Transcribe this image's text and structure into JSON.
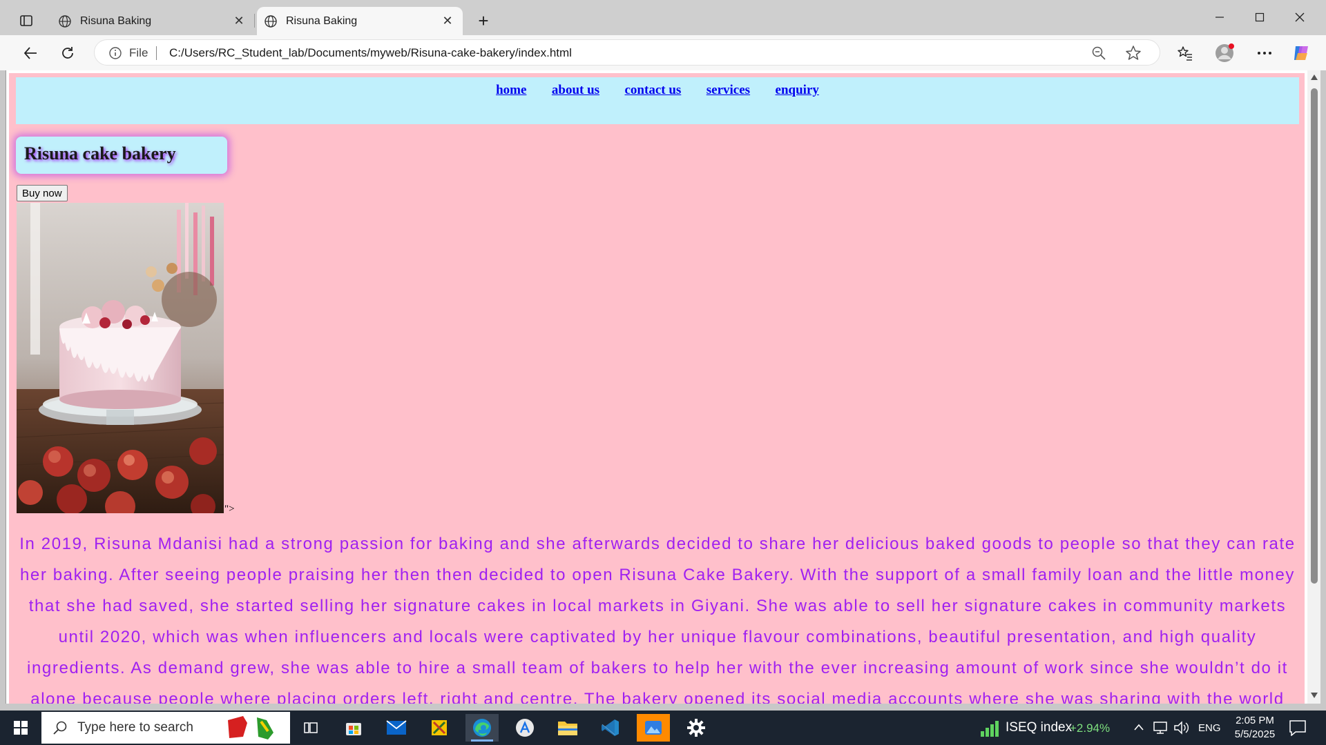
{
  "browser": {
    "tabs": [
      {
        "title": "Risuna Baking",
        "active": false
      },
      {
        "title": "Risuna Baking",
        "active": true
      }
    ],
    "address": {
      "scheme_label": "File",
      "url": "C:/Users/RC_Student_lab/Documents/myweb/Risuna-cake-bakery/index.html"
    },
    "icons": {
      "tab_actions": "tab-actions-icon",
      "back": "back-arrow-icon",
      "refresh": "refresh-icon",
      "info": "info-icon",
      "zoom": "zoom-out-icon",
      "favorite": "star-icon",
      "favorites": "favorites-icon",
      "profile": "profile-icon",
      "more": "more-icon",
      "copilot": "copilot-icon"
    }
  },
  "page": {
    "background": "#ffc0cb",
    "nav_background": "#c0f0fc",
    "nav_links": [
      "home",
      "about us",
      "contact us",
      "services",
      "enquiry"
    ],
    "brand_title": "Risuna cake bakery",
    "buy_button": "Buy now",
    "image_alt": "Pink drip cake topped with macarons on a glass stand",
    "stray_text": "\">",
    "text_color": "#a020f0",
    "story_lines": [
      "In 2019, Risuna Mdanisi had a strong passion for baking and she afterwards decided to share her delicious baked goods to people so that they can rate",
      "her baking. After seeing people praising her then then decided to open Risuna Cake Bakery. With the support of a small family loan and the little money",
      "that she had saved, she started selling her signature cakes in local markets in Giyani. She was able to sell her signature cakes in community markets",
      "until 2020, which was when influencers and locals were captivated by her unique flavour combinations, beautiful presentation, and high quality",
      "ingredients. As demand grew, she was able to hire a small team of bakers to help her with the ever increasing amount of work since she wouldn’t do it",
      "alone because people where placing orders left, right and centre. The bakery opened its social media accounts where she was sharing with the world"
    ]
  },
  "taskbar": {
    "search_placeholder": "Type here to search",
    "stock_name": "ISEQ index",
    "stock_change": "+2.94%",
    "language": "ENG",
    "time": "2:05 PM",
    "date": "5/5/2025"
  }
}
